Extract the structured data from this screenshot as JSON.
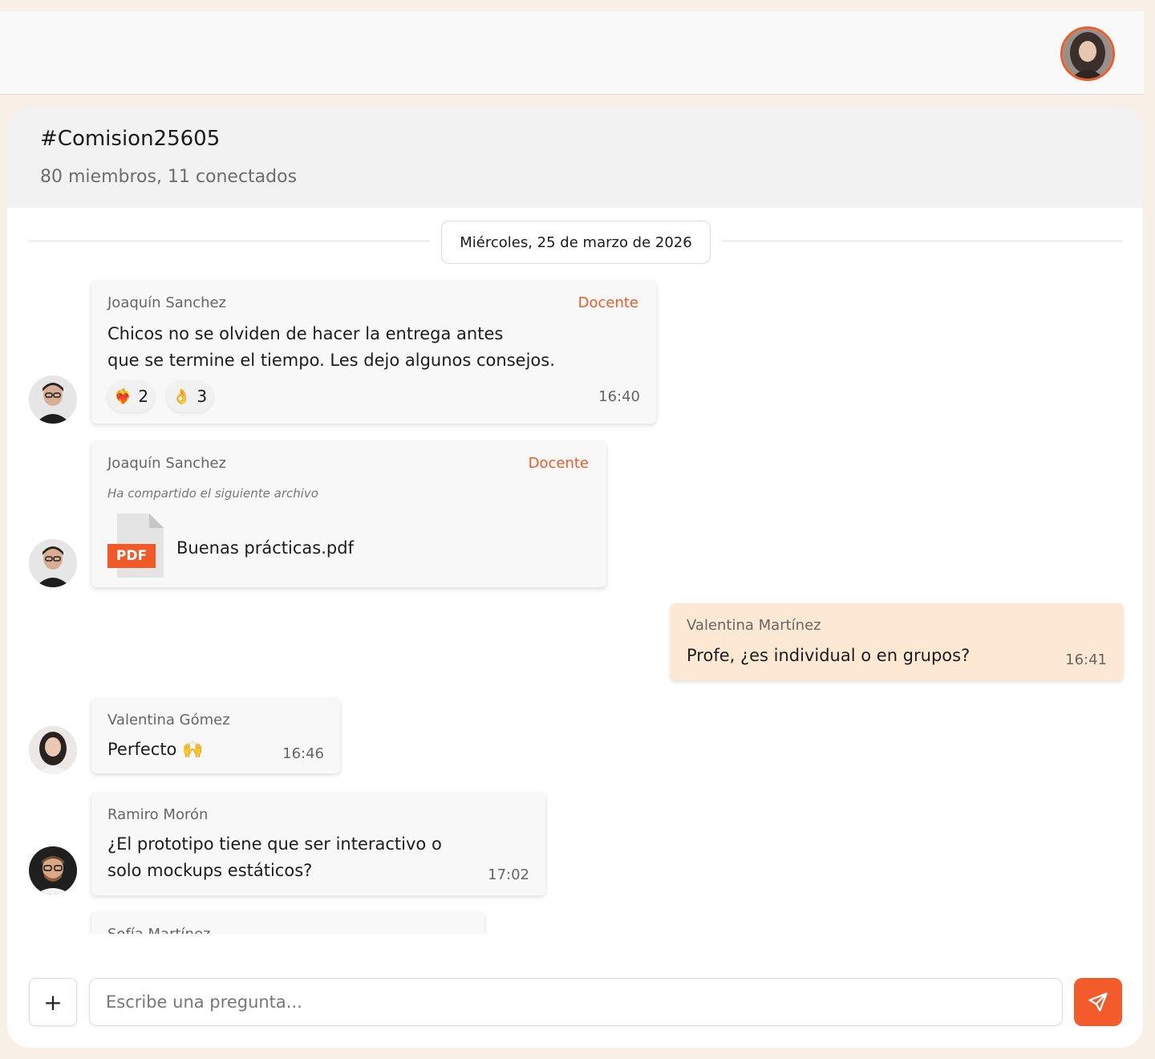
{
  "header": {
    "user_avatar_icon": "user-avatar"
  },
  "channel": {
    "title": "#Comision25605",
    "subtitle": "80 miembros, 11 conectados"
  },
  "date_separator": "Miércoles, 25 de marzo de 2026",
  "messages": [
    {
      "sender": "Joaquín Sanchez",
      "role": "Docente",
      "text_line1": "Chicos no se olviden de hacer la entrega antes",
      "text_line2": "que se termine el tiempo. Les dejo algunos consejos.",
      "time": "16:40",
      "reactions": [
        {
          "emoji": "❤️‍🔥",
          "icon": "heart-icon",
          "count": "2"
        },
        {
          "emoji": "👌",
          "icon": "ok-hand-icon",
          "count": "3"
        }
      ]
    },
    {
      "sender": "Joaquín Sanchez",
      "role": "Docente",
      "note": "Ha compartido el siguiente archivo",
      "file_badge": "PDF",
      "file_name": "Buenas prácticas.pdf"
    },
    {
      "sender": "Valentina Martínez",
      "text": "Profe, ¿es individual o en grupos?",
      "time": "16:41",
      "mine": true
    },
    {
      "sender": "Valentina Gómez",
      "text": "Perfecto 🙌",
      "time": "16:46"
    },
    {
      "sender": "Ramiro Morón",
      "text_line1": "¿El prototipo tiene que ser interactivo o",
      "text_line2": "solo mockups estáticos?",
      "time": "17:02"
    },
    {
      "sender": "Sofía Martínez"
    }
  ],
  "composer": {
    "add_label": "+",
    "placeholder": "Escribe una pregunta...",
    "send_icon": "send-icon"
  },
  "colors": {
    "accent": "#f45b2a",
    "mine_bubble": "#fde8d3",
    "background": "#f8efe6"
  }
}
